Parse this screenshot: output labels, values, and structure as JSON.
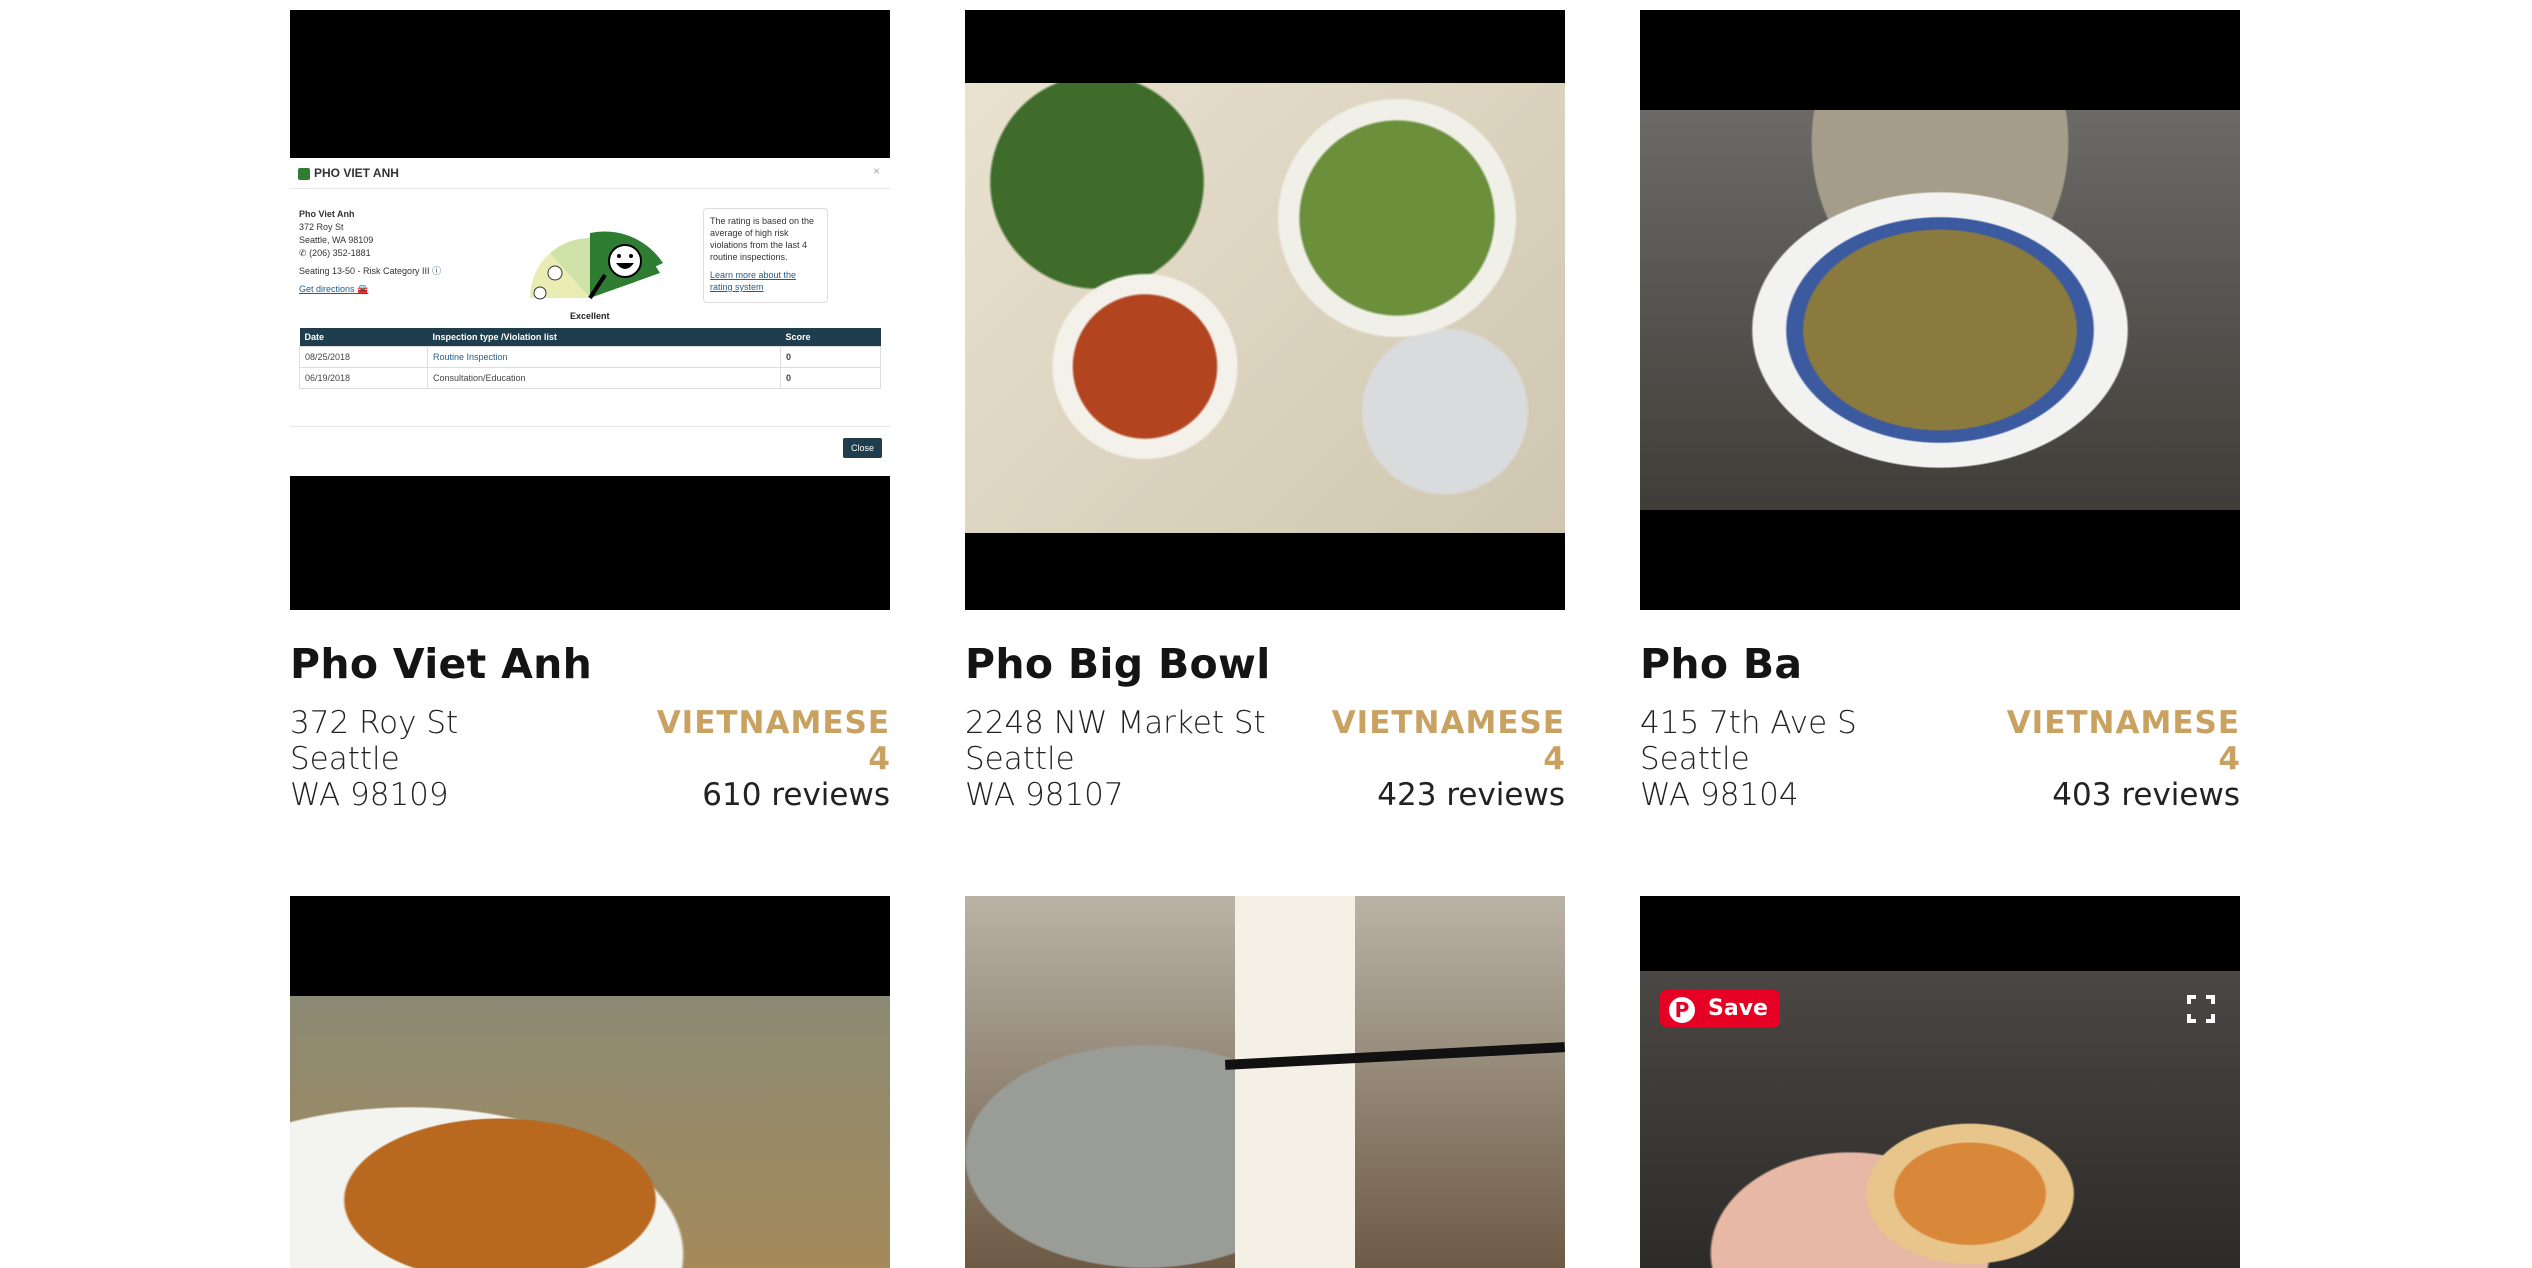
{
  "restaurants": [
    {
      "name": "Pho Viet Anh",
      "street": "372 Roy St",
      "city": "Seattle",
      "statezip": "WA 98109",
      "cuisine": "VIETNAMESE",
      "rating": "4",
      "reviews": "610 reviews"
    },
    {
      "name": "Pho Big Bowl",
      "street": "2248 NW Market St",
      "city": "Seattle",
      "statezip": "WA 98107",
      "cuisine": "VIETNAMESE",
      "rating": "4",
      "reviews": "423 reviews"
    },
    {
      "name": "Pho Ba",
      "street": "415 7th Ave S",
      "city": "Seattle",
      "statezip": "WA 98104",
      "cuisine": "VIETNAMESE",
      "rating": "4",
      "reviews": "403 reviews"
    }
  ],
  "inspection": {
    "title": "PHO VIET ANH",
    "close_x": "×",
    "info_name": "Pho Viet Anh",
    "info_street": "372 Roy St",
    "info_city": "Seattle, WA 98109",
    "info_phone": "(206) 352-1881",
    "info_seating": "Seating 13-50 - Risk Category III",
    "directions": "Get directions",
    "gauge_label": "Excellent",
    "note": "The rating is based on the average of high risk violations from the last 4 routine inspections.",
    "note_link": "Learn more about the rating system",
    "col_date": "Date",
    "col_type": "Inspection type /Violation list",
    "col_score": "Score",
    "rows": [
      {
        "date": "08/25/2018",
        "type": "Routine Inspection",
        "score": "0"
      },
      {
        "date": "06/19/2018",
        "type": "Consultation/Education",
        "score": "0"
      }
    ],
    "close_label": "Close"
  },
  "pinterest": {
    "save_label": "Save"
  },
  "colors": {
    "accent": "#c9a261",
    "modal_header": "#1f3d4d",
    "pinterest": "#e60023"
  }
}
